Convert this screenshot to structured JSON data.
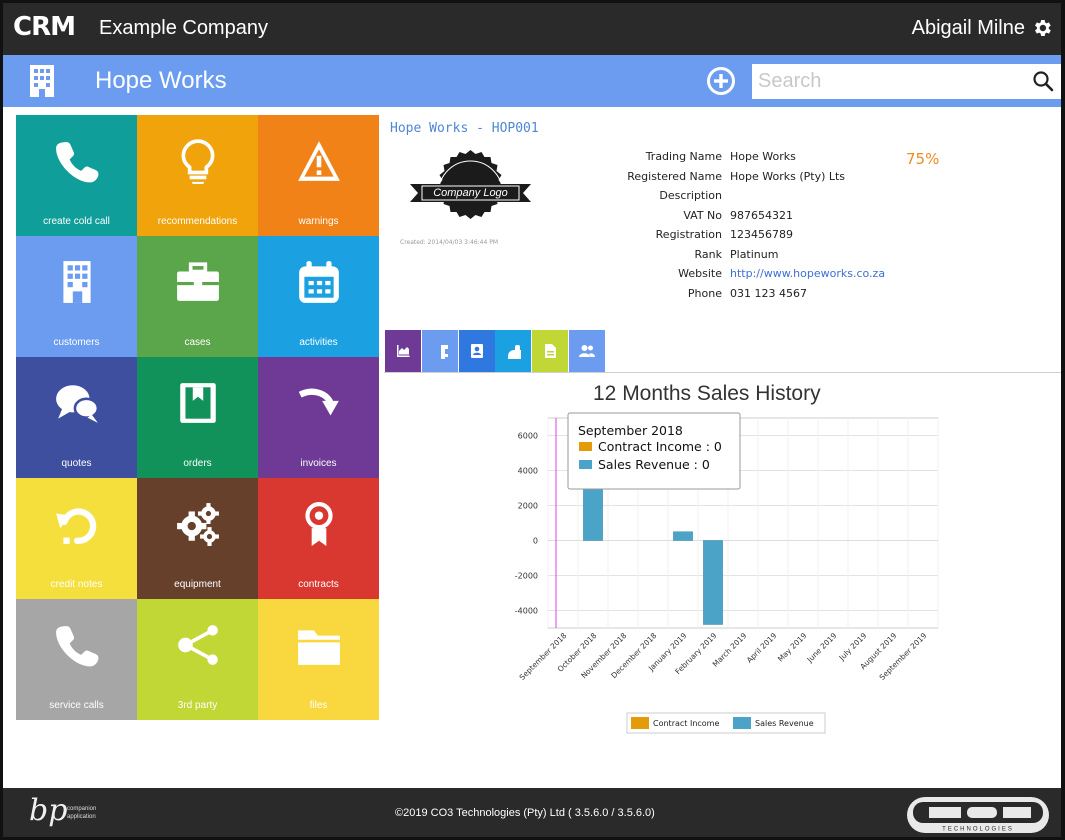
{
  "header": {
    "logo_text": "CRM",
    "company": "Example Company",
    "user": "Abigail Milne",
    "settings_icon": "gear-icon"
  },
  "titlebar": {
    "title": "Hope Works",
    "add_icon": "plus-circle-icon",
    "search_placeholder": "Search",
    "search_value": ""
  },
  "tiles": [
    {
      "label": "create cold call",
      "icon": "phone-icon",
      "color": "#0f9e99"
    },
    {
      "label": "recommendations",
      "icon": "lightbulb-icon",
      "color": "#f0a30a"
    },
    {
      "label": "warnings",
      "icon": "warning-icon",
      "color": "#f08218"
    },
    {
      "label": "customers",
      "icon": "building-icon",
      "color": "#6b9cf0"
    },
    {
      "label": "cases",
      "icon": "briefcase-icon",
      "color": "#5ba64a"
    },
    {
      "label": "activities",
      "icon": "calendar-icon",
      "color": "#1ba1e2"
    },
    {
      "label": "quotes",
      "icon": "speech-bubbles-icon",
      "color": "#3e4fa0"
    },
    {
      "label": "orders",
      "icon": "book-icon",
      "color": "#10925a"
    },
    {
      "label": "invoices",
      "icon": "curved-arrow-icon",
      "color": "#6e3a96"
    },
    {
      "label": "credit notes",
      "icon": "undo-icon",
      "color": "#f4df3c"
    },
    {
      "label": "equipment",
      "icon": "gears-icon",
      "color": "#66402b"
    },
    {
      "label": "contracts",
      "icon": "award-icon",
      "color": "#d93831"
    },
    {
      "label": "service calls",
      "icon": "phone-icon",
      "color": "#a6a6a6"
    },
    {
      "label": "3rd party",
      "icon": "share-icon",
      "color": "#c1d735"
    },
    {
      "label": "files",
      "icon": "folder-icon",
      "color": "#f9d73f"
    }
  ],
  "record": {
    "title": "Hope Works - HOP001",
    "logo_text": "Company Logo",
    "created": "Created: 2014/04/03 3:46:44 PM",
    "completeness": "75%",
    "fields": [
      {
        "label": "Trading Name",
        "value": "Hope Works",
        "link": false
      },
      {
        "label": "Registered Name",
        "value": "Hope Works (Pty) Lts",
        "link": false
      },
      {
        "label": "Description",
        "value": "",
        "link": false
      },
      {
        "label": "VAT No",
        "value": "987654321",
        "link": false
      },
      {
        "label": "Registration",
        "value": "123456789",
        "link": false
      },
      {
        "label": "Rank",
        "value": "Platinum",
        "link": false
      },
      {
        "label": "Website",
        "value": "http://www.hopeworks.co.za",
        "link": true
      },
      {
        "label": "Phone",
        "value": "031 123 4567",
        "link": false
      }
    ]
  },
  "tabs": [
    {
      "icon": "area-chart-icon",
      "color": "#6e3a96",
      "active": true
    },
    {
      "icon": "building-icon",
      "color": "#6b9cf0",
      "active": false
    },
    {
      "icon": "contact-card-icon",
      "color": "#2e78e0",
      "active": false
    },
    {
      "icon": "calendar-icon",
      "color": "#1ba1e2",
      "active": false
    },
    {
      "icon": "document-icon",
      "color": "#c1d735",
      "active": false
    },
    {
      "icon": "users-icon",
      "color": "#6b9cf0",
      "active": false
    }
  ],
  "chart_data": {
    "type": "bar",
    "title": "12 Months Sales History",
    "categories": [
      "September 2018",
      "October 2018",
      "November 2018",
      "December 2018",
      "January 2019",
      "February 2019",
      "March 2019",
      "April 2019",
      "May 2019",
      "June 2019",
      "July 2019",
      "August 2019",
      "September 2019"
    ],
    "series": [
      {
        "name": "Contract Income",
        "color": "#e39b0a",
        "values": [
          0,
          0,
          0,
          0,
          0,
          0,
          0,
          0,
          0,
          0,
          0,
          0,
          0
        ]
      },
      {
        "name": "Sales Revenue",
        "color": "#4ba3c7",
        "values": [
          0,
          3500,
          0,
          0,
          500,
          -4800,
          0,
          0,
          0,
          0,
          0,
          0,
          0
        ]
      }
    ],
    "ylim": [
      -5000,
      7000
    ],
    "yticks": [
      6000,
      4000,
      2000,
      0,
      -2000,
      -4000
    ],
    "grid": true,
    "legend": "bottom",
    "tooltip": {
      "title": "September 2018",
      "lines": [
        "Contract Income : 0",
        "Sales Revenue : 0"
      ]
    }
  },
  "footer": {
    "bp_logo": "bp",
    "bp_caption_1": "companion",
    "bp_caption_2": "application",
    "copyright": "©2019 CO3 Technologies (Pty) Ltd ( 3.5.6.0 / 3.5.6.0)",
    "co3_logo": "CO3",
    "co3_tagline": "TECHNOLOGIES"
  }
}
